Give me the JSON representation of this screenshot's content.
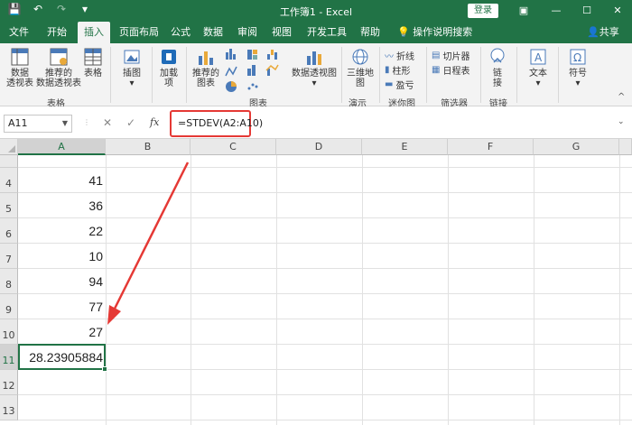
{
  "titlebar": {
    "title": "工作簿1  -  Excel",
    "login": "登录",
    "qat": {
      "save": "💾",
      "undo": "↶",
      "redo": "↷",
      "customize": "▾"
    },
    "window_buttons": {
      "ribbon_options": "▣",
      "minimize": "—",
      "restore": "☐",
      "close": "✕"
    }
  },
  "tabs": [
    "文件",
    "开始",
    "插入",
    "页面布局",
    "公式",
    "数据",
    "审阅",
    "视图",
    "开发工具",
    "帮助"
  ],
  "active_tab": "插入",
  "tell_me": "操作说明搜索",
  "share": "共享",
  "ribbon": {
    "pivot": "数据\n透视表",
    "recommended_pivot": "推荐的\n数据透视表",
    "table": "表格",
    "group_tables": "表格",
    "illustrations": "插图",
    "addins": "加载\n项",
    "recommended_charts": "推荐的\n图表",
    "pivot_chart": "数据透视图",
    "group_charts": "图表",
    "map3d": "三维地\n图",
    "group_tours": "演示",
    "spark_line": "折线",
    "spark_column": "柱形",
    "spark_winloss": "盈亏",
    "group_sparklines": "迷你图",
    "slicer": "切片器",
    "timeline": "日程表",
    "group_filters": "筛选器",
    "link": "链\n接",
    "group_links": "链接",
    "text": "文本",
    "symbol": "符号"
  },
  "formula_bar": {
    "name_box": "A11",
    "cancel": "✕",
    "enter": "✓",
    "fx": "fx",
    "formula": "=STDEV(A2:A10)"
  },
  "grid": {
    "columns": [
      "A",
      "B",
      "C",
      "D",
      "E",
      "F",
      "G"
    ],
    "selected_column": "A",
    "rows": [
      {
        "row": "4",
        "a": "41"
      },
      {
        "row": "5",
        "a": "36"
      },
      {
        "row": "6",
        "a": "22"
      },
      {
        "row": "7",
        "a": "10"
      },
      {
        "row": "8",
        "a": "94"
      },
      {
        "row": "9",
        "a": "77"
      },
      {
        "row": "10",
        "a": "27"
      },
      {
        "row": "11",
        "a": "28.23905884"
      },
      {
        "row": "12",
        "a": ""
      },
      {
        "row": "13",
        "a": ""
      }
    ],
    "selected_row": "11",
    "accent": "#217346",
    "annotation_color": "#e53935"
  }
}
